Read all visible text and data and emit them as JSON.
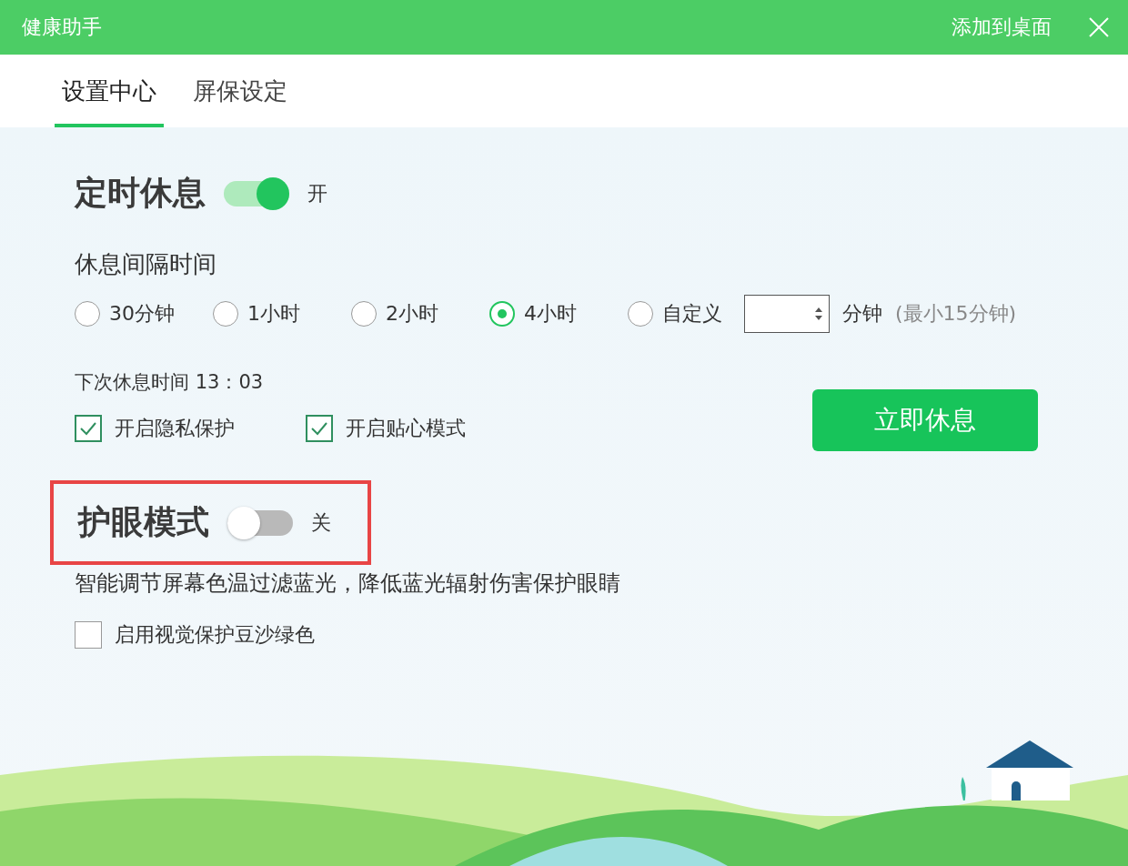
{
  "window": {
    "title": "健康助手",
    "action": "添加到桌面"
  },
  "tabs": [
    {
      "label": "设置中心",
      "selected": true
    },
    {
      "label": "屏保设定",
      "selected": false
    }
  ],
  "rest": {
    "title": "定时休息",
    "on": true,
    "state_label": "开",
    "interval_label": "休息间隔时间",
    "options": [
      {
        "label": "30分钟",
        "selected": false
      },
      {
        "label": "1小时",
        "selected": false
      },
      {
        "label": "2小时",
        "selected": false
      },
      {
        "label": "4小时",
        "selected": true
      },
      {
        "label": "自定义",
        "selected": false
      }
    ],
    "unit": "分钟",
    "hint": "(最小15分钟)",
    "next_time": "下次休息时间 13：03",
    "checks": [
      {
        "label": "开启隐私保护",
        "checked": true
      },
      {
        "label": "开启贴心模式",
        "checked": true
      }
    ],
    "button": "立即休息"
  },
  "eye_care": {
    "title": "护眼模式",
    "on": false,
    "state_label": "关",
    "highlighted": true,
    "description": "智能调节屏幕色温过滤蓝光，降低蓝光辐射伤害保护眼睛",
    "checks": [
      {
        "label": "启用视觉保护豆沙绿色",
        "checked": false
      }
    ]
  }
}
